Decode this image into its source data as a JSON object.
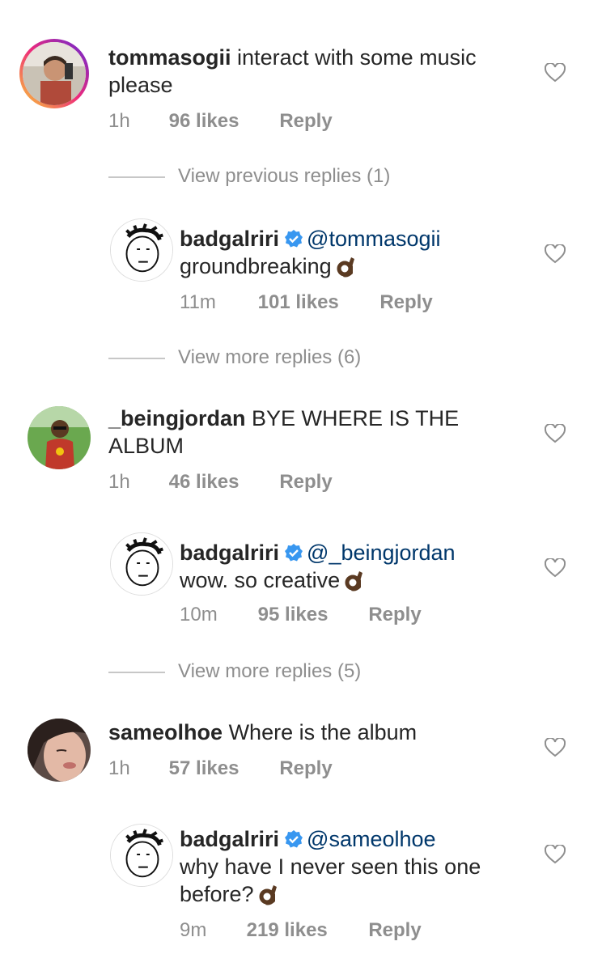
{
  "comments": [
    {
      "username": "tommasogii",
      "text": "interact with some music please",
      "time": "1h",
      "likes": "96 likes",
      "reply": "Reply",
      "replies_link": "View previous replies (1)",
      "reply_item": {
        "username": "badgalriri",
        "mention": "@tommasogii",
        "text": "groundbreaking",
        "time": "11m",
        "likes": "101 likes",
        "reply": "Reply",
        "more_link": "View more replies (6)"
      }
    },
    {
      "username": "_beingjordan",
      "text": "BYE WHERE IS THE ALBUM",
      "time": "1h",
      "likes": "46 likes",
      "reply": "Reply",
      "reply_item": {
        "username": "badgalriri",
        "mention": "@_beingjordan",
        "text": "wow. so creative",
        "time": "10m",
        "likes": "95 likes",
        "reply": "Reply",
        "more_link": "View more replies (5)"
      }
    },
    {
      "username": "sameolhoe",
      "text": "Where is the album",
      "time": "1h",
      "likes": "57 likes",
      "reply": "Reply",
      "reply_item": {
        "username": "badgalriri",
        "mention": "@sameolhoe",
        "text": "why have I never seen this one before?",
        "time": "9m",
        "likes": "219 likes",
        "reply": "Reply"
      }
    }
  ],
  "icons": {
    "like": "heart-outline-icon",
    "verified": "verified-badge-icon",
    "emoji": "ok-hand-emoji"
  },
  "colors": {
    "text": "#262626",
    "muted": "#8e8e8e",
    "mention": "#00376b",
    "verified": "#3897f0"
  }
}
